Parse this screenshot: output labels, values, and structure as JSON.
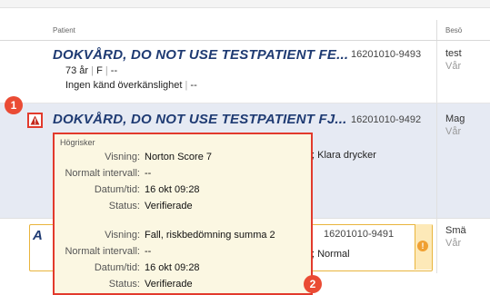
{
  "header": {
    "patient_label": "Patient",
    "besok_label": "Besö"
  },
  "rows": [
    {
      "name": "DOKVÅRD, DO NOT USE TESTPATIENT FE...",
      "pid": "16201010-9493",
      "age": "73 år",
      "sex": "F",
      "extra": "--",
      "allergy": "Ingen känd överkänslighet",
      "allergy_extra": "--",
      "besok_a": "test",
      "besok_b": "Vår"
    },
    {
      "name": "DOKVÅRD, DO NOT USE TESTPATIENT FJ...",
      "pid": "16201010-9492",
      "diet_fragment": "; Klara drycker",
      "besok_a": "Mag",
      "besok_b": "Vår"
    },
    {
      "name_fragment": "A",
      "pid": "16201010-9491",
      "diet_fragment": "; Normal",
      "besok_a": "Smä",
      "besok_b": "Vår",
      "warn_glyph": "!"
    }
  ],
  "popup": {
    "title": "Högrisker",
    "entries": [
      {
        "visning_label": "Visning:",
        "visning": "Norton Score 7",
        "intervall_label": "Normalt intervall:",
        "intervall": "--",
        "datum_label": "Datum/tid:",
        "datum": "16 okt 09:28",
        "status_label": "Status:",
        "status": "Verifierade"
      },
      {
        "visning_label": "Visning:",
        "visning": "Fall, riskbedömning summa 2",
        "intervall_label": "Normalt intervall:",
        "intervall": "--",
        "datum_label": "Datum/tid:",
        "datum": "16 okt 09:28",
        "status_label": "Status:",
        "status": "Verifierade"
      }
    ]
  },
  "badges": {
    "one": "1",
    "two": "2"
  },
  "icons": {
    "warning": "warning-triangle-icon",
    "alert_dot": "alert-circle-icon"
  },
  "colors": {
    "highlight_red": "#e23a2c",
    "badge_red": "#ea4b34",
    "name_blue": "#1f3b73",
    "popup_bg": "#fbf7e2",
    "selected_row": "#e6eaf3",
    "warning_orange": "#f0a032"
  }
}
